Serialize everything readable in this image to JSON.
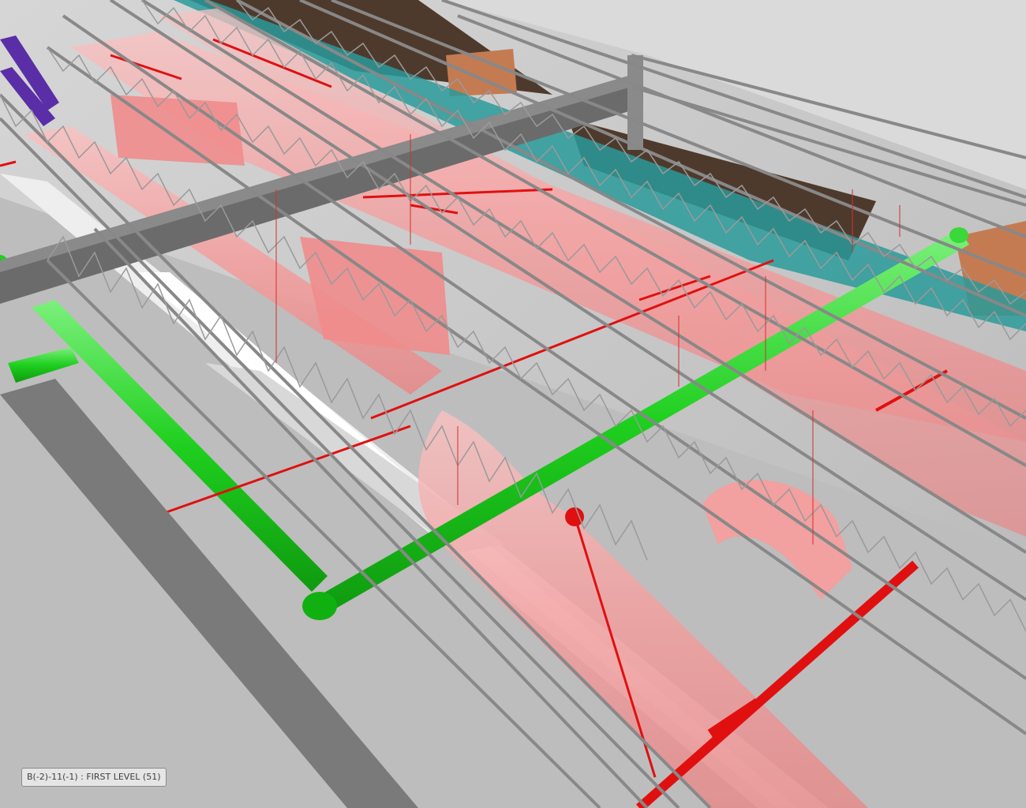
{
  "viewport": {
    "location_label": "B(-2)-11(-1) : FIRST LEVEL (51)"
  },
  "colors": {
    "background_floor": "#c4c4c4",
    "ceiling_plane": "#d8d8d8",
    "steel_truss": "#8c8c8c",
    "steel_beam": "#6e6e6e",
    "hvac_duct": "#f2a6a6",
    "fire_sprinkler_pipe": "#e01010",
    "domestic_water_pipe": "#22c422",
    "chilled_water_pipe": "#1a8a8a",
    "plumbing_pipe": "#5a2ea6",
    "equipment_brown": "#5a4030",
    "equipment_orange": "#c87a50"
  }
}
